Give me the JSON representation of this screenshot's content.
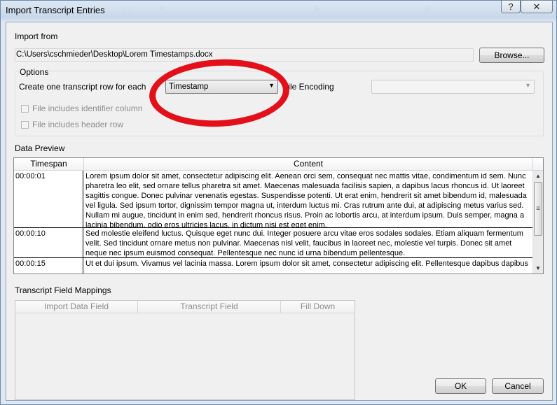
{
  "window": {
    "title": "Import Transcript Entries",
    "help_glyph": "?",
    "close_glyph": "✕"
  },
  "import_from": {
    "label": "Import from",
    "path": "C:\\Users\\cschmieder\\Desktop\\Lorem Timestamps.docx",
    "browse_label": "Browse..."
  },
  "options": {
    "label": "Options",
    "row_label": "Create one transcript row for each",
    "row_value": "Timestamp",
    "encoding_label": "File Encoding",
    "encoding_value": "",
    "identifier_checkbox_label": "File includes identifier column",
    "identifier_checked": false,
    "header_checkbox_label": "File includes header row",
    "header_checked": false
  },
  "data_preview": {
    "label": "Data Preview",
    "columns": [
      "Timespan",
      "Content"
    ],
    "rows": [
      {
        "timespan": "00:00:01",
        "content": "Lorem ipsum dolor sit amet, consectetur adipiscing elit. Aenean orci sem, consequat nec mattis vitae, condimentum id sem. Nunc pharetra leo elit, sed ornare tellus pharetra sit amet. Maecenas malesuada facilisis sapien, a dapibus lacus rhoncus id. Ut laoreet sagittis congue. Donec pulvinar venenatis egestas. Suspendisse potenti. Ut erat enim, hendrerit sit amet bibendum id, malesuada vel ligula. Sed ipsum tortor, dignissim tempor magna ut, interdum luctus mi. Cras rutrum ante dui, at adipiscing metus varius sed. Nullam mi augue, tincidunt in enim sed, hendrerit rhoncus risus. Proin ac lobortis arcu, at interdum ipsum. Duis semper, magna a lacinia bibendum, odio eros ultricies lacus, in dictum nisi est eget enim."
      },
      {
        "timespan": "00:00:10",
        "content": "Sed molestie eleifend luctus. Quisque eget nunc dui. Integer posuere arcu vitae eros sodales sodales. Etiam aliquam fermentum velit. Sed tincidunt ornare metus non pulvinar. Maecenas nisl velit, faucibus in laoreet nec, molestie vel turpis. Donec sit amet neque nec ipsum euismod consequat. Pellentesque nec nunc id urna bibendum pellentesque."
      },
      {
        "timespan": "00:00:15",
        "content": "Ut et dui ipsum. Vivamus vel lacinia massa. Lorem ipsum dolor sit amet, consectetur adipiscing elit. Pellentesque dapibus dapibus"
      }
    ]
  },
  "mappings": {
    "label": "Transcript Field Mappings",
    "columns": [
      "Import Data Field",
      "Transcript Field",
      "Fill Down"
    ]
  },
  "buttons": {
    "ok": "OK",
    "cancel": "Cancel"
  },
  "annotation": {
    "color": "#e3101a"
  }
}
